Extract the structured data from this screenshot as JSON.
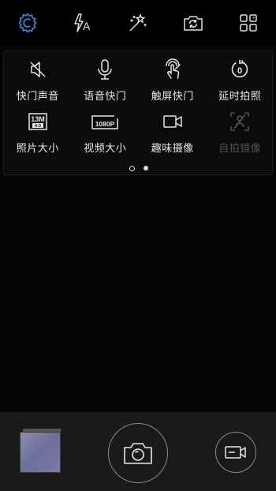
{
  "top_bar": {
    "items": [
      {
        "icon": "settings-gear-icon",
        "active": true
      },
      {
        "icon": "flash-auto-icon"
      },
      {
        "icon": "magic-wand-filter-icon"
      },
      {
        "icon": "switch-camera-icon"
      },
      {
        "icon": "modes-grid-icon"
      }
    ],
    "flash_glyph": "A",
    "accent_color": "#3a8fdc"
  },
  "settings_panel": {
    "items": [
      {
        "label": "快门声音",
        "icon": "shutter-sound-muted-icon"
      },
      {
        "label": "语音快门",
        "icon": "voice-shutter-mic-icon"
      },
      {
        "label": "触屏快门",
        "icon": "touch-shutter-icon"
      },
      {
        "label": "延时拍照",
        "icon": "timer-icon",
        "value": "0"
      },
      {
        "label": "照片大小",
        "icon": "photo-size-icon",
        "value": "13M",
        "sub": "4:3"
      },
      {
        "label": "视频大小",
        "icon": "video-size-icon",
        "value": "1080P"
      },
      {
        "label": "趣味摄像",
        "icon": "fun-video-icon"
      },
      {
        "label": "自拍镜像",
        "icon": "selfie-mirror-icon",
        "disabled": true
      }
    ],
    "page_indicator": {
      "pages": 2,
      "current": 1
    }
  },
  "bottom_bar": {
    "gallery_thumbnail": "gallery-thumbnail",
    "shutter_icon": "camera-shutter-icon",
    "video_icon": "video-record-icon"
  }
}
